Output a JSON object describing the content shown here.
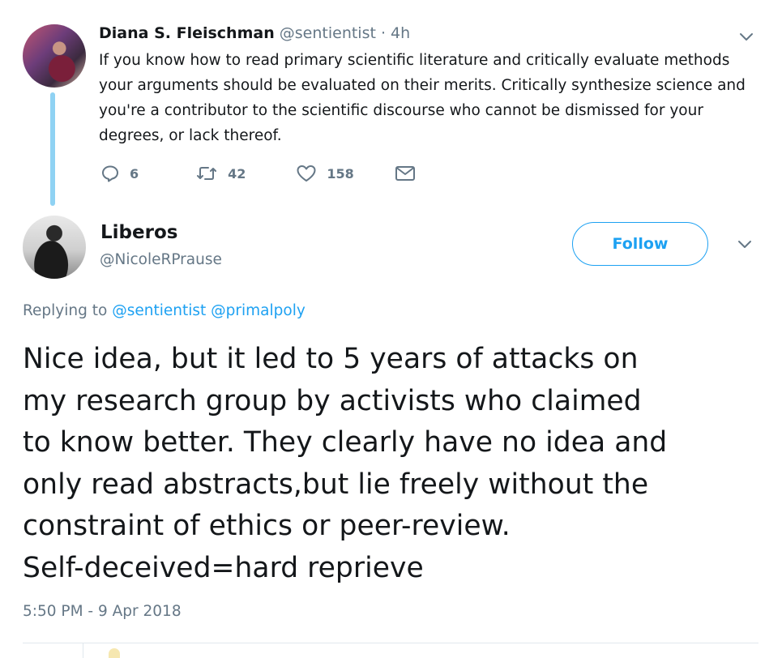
{
  "parent_tweet": {
    "author_name": "Diana S. Fleischman",
    "meta": "@sentientist · 4h",
    "text": "If you know how to read primary scientific literature and critically evaluate methods your arguments should be evaluated on their merits. Critically synthesize science and you're a contributor to the scientific discourse who cannot be dismissed for your degrees, or lack thereof.",
    "reply_count": "6",
    "retweet_count": "42",
    "like_count": "158"
  },
  "main_tweet": {
    "author_name": "Liberos",
    "handle": "@NicoleRPrause",
    "follow_label": "Follow",
    "replying_prefix": "Replying to",
    "mention_1": "@sentientist",
    "mention_2": "@primalpoly",
    "text_lines": [
      "Nice idea, but it led to 5 years of attacks on",
      "my research group by activists who claimed",
      "to know better. They clearly have no idea and",
      "only read abstracts,but lie freely without the",
      "constraint of ethics or peer-review.",
      "Self-deceived=hard reprieve"
    ],
    "timestamp": "5:50 PM - 9 Apr 2018"
  },
  "icons": {
    "reply": "reply-icon",
    "retweet": "retweet-icon",
    "like": "heart-icon",
    "message": "envelope-icon",
    "menu": "chevron-down-icon"
  },
  "colors": {
    "accent": "#1da1f2",
    "muted_text": "#657786",
    "thread_line": "#8fd2f3",
    "primary_text": "#14171a"
  }
}
